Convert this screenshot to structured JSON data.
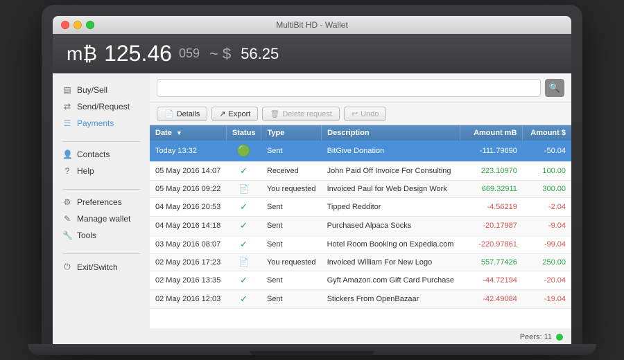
{
  "window": {
    "title": "MultiBit HD - Wallet"
  },
  "header": {
    "btc_amount": "125.46",
    "btc_small": "059",
    "usd_separator": "~ $",
    "usd_amount": "56.25"
  },
  "sidebar": {
    "items": [
      {
        "id": "buy-sell",
        "label": "Buy/Sell",
        "icon": "▤",
        "active": false
      },
      {
        "id": "send-request",
        "label": "Send/Request",
        "icon": "⇄",
        "active": false
      },
      {
        "id": "payments",
        "label": "Payments",
        "icon": "☰",
        "active": true
      },
      {
        "id": "contacts",
        "label": "Contacts",
        "icon": "👤",
        "active": false
      },
      {
        "id": "help",
        "label": "Help",
        "icon": "?",
        "active": false
      },
      {
        "id": "preferences",
        "label": "Preferences",
        "icon": "⚙",
        "active": false
      },
      {
        "id": "manage-wallet",
        "label": "Manage wallet",
        "icon": "✎",
        "active": false
      },
      {
        "id": "tools",
        "label": "Tools",
        "icon": "🔧",
        "active": false
      },
      {
        "id": "exit-switch",
        "label": "Exit/Switch",
        "icon": "⏻",
        "active": false
      }
    ]
  },
  "toolbar": {
    "details_label": "Details",
    "export_label": "Export",
    "delete_label": "Delete request",
    "undo_label": "Undo"
  },
  "search": {
    "placeholder": ""
  },
  "table": {
    "headers": [
      "Date",
      "Status",
      "Type",
      "Description",
      "Amount mB",
      "Amount $"
    ],
    "rows": [
      {
        "date": "Today 13:32",
        "status": "sent_pending",
        "type": "Sent",
        "desc": "BitGive Donation",
        "amount_btc": "-111.79690",
        "amount_usd": "-50.04",
        "selected": true
      },
      {
        "date": "05 May 2016 14:07",
        "status": "received",
        "type": "Received",
        "desc": "John Paid Off Invoice For Consulting",
        "amount_btc": "223.10970",
        "amount_usd": "100.00",
        "selected": false
      },
      {
        "date": "05 May 2016 09:22",
        "status": "requested",
        "type": "You requested",
        "desc": "Invoiced Paul for Web Design Work",
        "amount_btc": "669.32911",
        "amount_usd": "300.00",
        "selected": false
      },
      {
        "date": "04 May 2016 20:53",
        "status": "sent",
        "type": "Sent",
        "desc": "Tipped Redditor",
        "amount_btc": "-4.56219",
        "amount_usd": "-2.04",
        "selected": false
      },
      {
        "date": "04 May 2016 14:18",
        "status": "sent",
        "type": "Sent",
        "desc": "Purchased Alpaca Socks",
        "amount_btc": "-20.17987",
        "amount_usd": "-9.04",
        "selected": false
      },
      {
        "date": "03 May 2016 08:07",
        "status": "sent",
        "type": "Sent",
        "desc": "Hotel Room Booking on Expedia.com",
        "amount_btc": "-220.97861",
        "amount_usd": "-99.04",
        "selected": false
      },
      {
        "date": "02 May 2016 17:23",
        "status": "requested",
        "type": "You requested",
        "desc": "Invoiced William For New Logo",
        "amount_btc": "557.77426",
        "amount_usd": "250.00",
        "selected": false
      },
      {
        "date": "02 May 2016 13:35",
        "status": "sent",
        "type": "Sent",
        "desc": "Gyft Amazon.com Gift Card Purchase",
        "amount_btc": "-44.72194",
        "amount_usd": "-20.04",
        "selected": false
      },
      {
        "date": "02 May 2016 12:03",
        "status": "sent",
        "type": "Sent",
        "desc": "Stickers From OpenBazaar",
        "amount_btc": "-42.49084",
        "amount_usd": "-19.04",
        "selected": false
      }
    ]
  },
  "bottom": {
    "peers_label": "Peers: 11"
  }
}
